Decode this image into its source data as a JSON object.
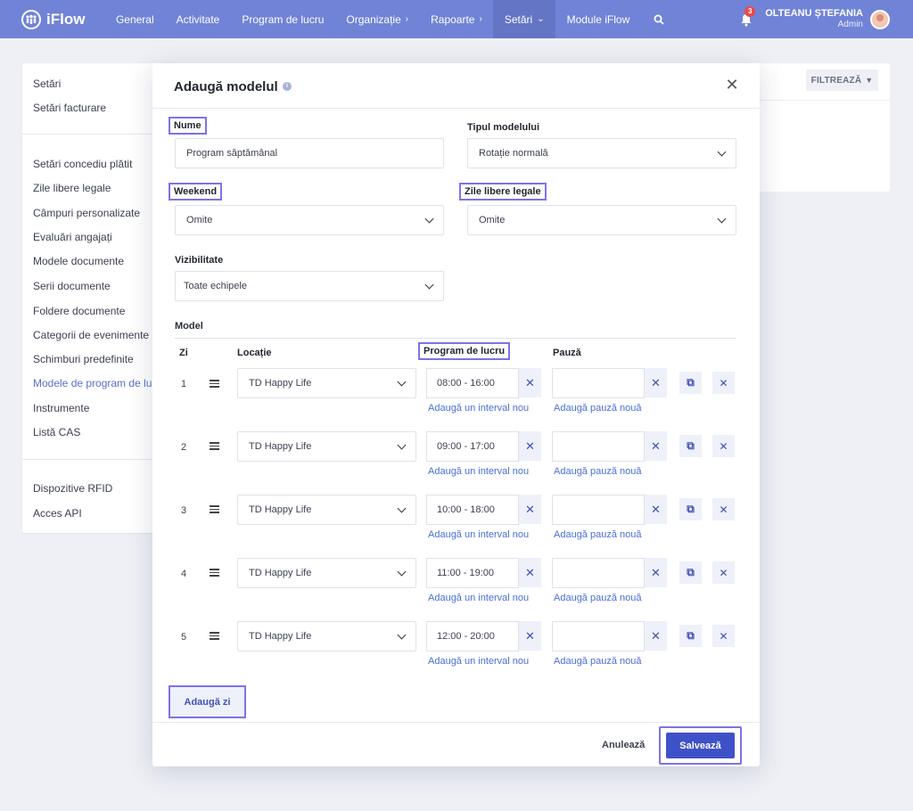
{
  "app": {
    "name": "iFlow"
  },
  "nav": {
    "items": [
      {
        "label": "General"
      },
      {
        "label": "Activitate"
      },
      {
        "label": "Program de lucru"
      },
      {
        "label": "Organizație"
      },
      {
        "label": "Rapoarte"
      },
      {
        "label": "Setări"
      },
      {
        "label": "Module iFlow"
      }
    ],
    "notification_count": "3",
    "user_name": "OLTEANU ȘTEFANIA",
    "user_role": "Admin"
  },
  "sidebar": {
    "items": [
      {
        "label": "Setări"
      },
      {
        "label": "Setări facturare"
      },
      {
        "label": "Setări concediu plătit"
      },
      {
        "label": "Zile libere legale"
      },
      {
        "label": "Câmpuri personalizate"
      },
      {
        "label": "Evaluări angajați"
      },
      {
        "label": "Modele documente"
      },
      {
        "label": "Serii documente"
      },
      {
        "label": "Foldere documente"
      },
      {
        "label": "Categorii de evenimente"
      },
      {
        "label": "Schimburi predefinite"
      },
      {
        "label": "Modele de program de lu"
      },
      {
        "label": "Instrumente"
      },
      {
        "label": "Listă CAS"
      },
      {
        "label": "Dispozitive RFID"
      },
      {
        "label": "Acces API"
      }
    ]
  },
  "filter": {
    "label": "FILTREAZĂ"
  },
  "modal": {
    "title": "Adaugă modelul",
    "name_label": "Nume",
    "name_value": "Program săptămânal",
    "type_label": "Tipul modelului",
    "type_value": "Rotație normală",
    "weekend_label": "Weekend",
    "weekend_value": "Omite",
    "holidays_label": "Zile libere legale",
    "holidays_value": "Omite",
    "visibility_label": "Vizibilitate",
    "visibility_value": "Toate echipele",
    "model_title": "Model",
    "columns": {
      "day": "Zi",
      "location": "Locație",
      "schedule": "Program de lucru",
      "pause": "Pauză"
    },
    "rows": [
      {
        "day": "1",
        "location": "TD Happy Life",
        "interval": "08:00 - 16:00"
      },
      {
        "day": "2",
        "location": "TD Happy Life",
        "interval": "09:00 - 17:00"
      },
      {
        "day": "3",
        "location": "TD Happy Life",
        "interval": "10:00 - 18:00"
      },
      {
        "day": "4",
        "location": "TD Happy Life",
        "interval": "11:00 - 19:00"
      },
      {
        "day": "5",
        "location": "TD Happy Life",
        "interval": "12:00 - 20:00"
      }
    ],
    "add_interval_label": "Adaugă un interval nou",
    "add_pause_label": "Adaugă pauză nouă",
    "add_day_label": "Adaugă zi",
    "cancel_label": "Anulează",
    "save_label": "Salvează"
  }
}
